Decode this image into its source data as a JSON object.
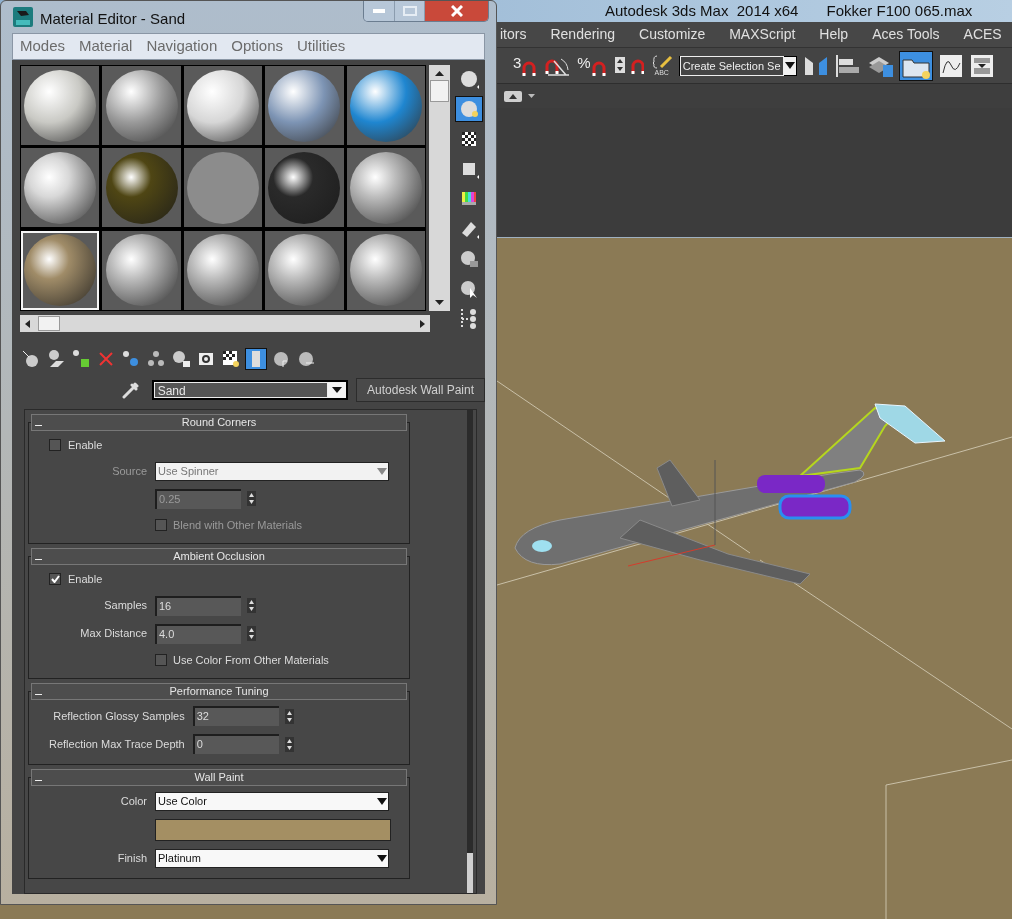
{
  "app": {
    "title": "Autodesk 3ds Max  2014 x64",
    "file": "Fokker F100 065.max",
    "menu": [
      "itors",
      "Rendering",
      "Customize",
      "MAXScript",
      "Help",
      "Aces Tools",
      "ACES"
    ],
    "tools": [
      {
        "kind": "snap",
        "label": "3",
        "selected": false
      },
      {
        "kind": "angle_snap",
        "selected": false
      },
      {
        "kind": "snap",
        "label": "%",
        "selected": false
      },
      {
        "kind": "spinner_snap",
        "selected": false
      },
      {
        "kind": "named_sets",
        "label": "ABC",
        "selected": false
      },
      {
        "kind": "selection_set",
        "value": "Create Selection Se"
      },
      {
        "kind": "mirror",
        "selected": false
      },
      {
        "kind": "align",
        "selected": false
      },
      {
        "kind": "layers",
        "selected": false
      },
      {
        "kind": "explorer",
        "selected": true
      },
      {
        "kind": "curve",
        "selected": false
      },
      {
        "kind": "schematic",
        "selected": false
      }
    ]
  },
  "editor": {
    "title": "Material Editor - Sand",
    "menu": [
      "Modes",
      "Material",
      "Navigation",
      "Options",
      "Utilities"
    ],
    "slots": [
      {
        "kind": "textured",
        "color": "#c9c9c4",
        "selected": false
      },
      {
        "kind": "textured",
        "color": "#9a9a9a",
        "selected": false
      },
      {
        "kind": "textured",
        "color": "#d6d6d6",
        "selected": false
      },
      {
        "kind": "textured",
        "color": "#7d94b4",
        "selected": false
      },
      {
        "kind": "textured",
        "color": "#1f86d0",
        "selected": false
      },
      {
        "kind": "plain",
        "color": "#d8d8d8",
        "selected": false
      },
      {
        "kind": "plain",
        "color": "#4f4614",
        "selected": false
      },
      {
        "kind": "flat",
        "color": "#8c8c8c",
        "selected": false
      },
      {
        "kind": "plain",
        "color": "#2a2a2a",
        "selected": false
      },
      {
        "kind": "plain",
        "color": "#bdbdbd",
        "selected": false
      },
      {
        "kind": "plain",
        "color": "#a08c68",
        "selected": true
      },
      {
        "kind": "plain",
        "color": "#bdbdbd",
        "selected": false
      },
      {
        "kind": "plain",
        "color": "#bdbdbd",
        "selected": false
      },
      {
        "kind": "plain",
        "color": "#bdbdbd",
        "selected": false
      },
      {
        "kind": "plain",
        "color": "#bdbdbd",
        "selected": false
      }
    ],
    "side_tools": [
      {
        "kind": "sample_type",
        "selected": false
      },
      {
        "kind": "backlight",
        "selected": true
      },
      {
        "kind": "checker",
        "selected": false
      },
      {
        "kind": "uv",
        "selected": false
      },
      {
        "kind": "video",
        "selected": false
      },
      {
        "kind": "options",
        "selected": false
      },
      {
        "kind": "by_material",
        "selected": false
      },
      {
        "kind": "pick",
        "selected": false
      },
      {
        "kind": "navigator",
        "selected": false
      }
    ],
    "tools": [
      {
        "kind": "get",
        "selected": false
      },
      {
        "kind": "assign",
        "selected": false
      },
      {
        "kind": "reset",
        "selected": false
      },
      {
        "kind": "delete",
        "selected": false
      },
      {
        "kind": "copy",
        "selected": false
      },
      {
        "kind": "unique",
        "selected": false
      },
      {
        "kind": "library",
        "selected": false
      },
      {
        "kind": "effects",
        "selected": false
      },
      {
        "kind": "show_map",
        "selected": false
      },
      {
        "kind": "show_end",
        "selected": true
      },
      {
        "kind": "parent",
        "selected": false
      },
      {
        "kind": "sibling",
        "selected": false
      }
    ],
    "material_name": "Sand",
    "material_type": "Autodesk Wall Paint",
    "rollouts": [
      {
        "title": "Round Corners",
        "expanded": true,
        "rows": [
          {
            "kind": "checkbox",
            "label": "Enable",
            "checked": false
          },
          {
            "kind": "dropdown",
            "label": "Source",
            "value": "Use Spinner",
            "disabled": true
          },
          {
            "kind": "spinner",
            "value": "0.25",
            "disabled": true
          },
          {
            "kind": "option",
            "label": "Blend with Other Materials",
            "checked": false,
            "disabled": true
          }
        ]
      },
      {
        "title": "Ambient Occlusion",
        "expanded": true,
        "rows": [
          {
            "kind": "checkbox",
            "label": "Enable",
            "checked": true
          },
          {
            "kind": "spinner",
            "label": "Samples",
            "value": "16",
            "disabled": false
          },
          {
            "kind": "spinner",
            "label": "Max Distance",
            "value": "4.0",
            "disabled": false
          },
          {
            "kind": "option",
            "label": "Use Color From Other Materials",
            "checked": false,
            "disabled": false
          }
        ]
      },
      {
        "title": "Performance Tuning",
        "expanded": true,
        "rows": [
          {
            "kind": "spinner",
            "label": "Reflection Glossy Samples",
            "value": "32",
            "disabled": false
          },
          {
            "kind": "spinner",
            "label": "Reflection Max Trace Depth",
            "value": "0",
            "disabled": false
          }
        ]
      },
      {
        "title": "Wall Paint",
        "expanded": true,
        "rows": [
          {
            "kind": "dropdown",
            "label": "Color",
            "value": "Use Color",
            "disabled": false
          },
          {
            "kind": "swatch",
            "color": "#a48f63"
          },
          {
            "kind": "dropdown",
            "label": "Finish",
            "value": "Platinum",
            "disabled": false
          }
        ]
      }
    ]
  }
}
